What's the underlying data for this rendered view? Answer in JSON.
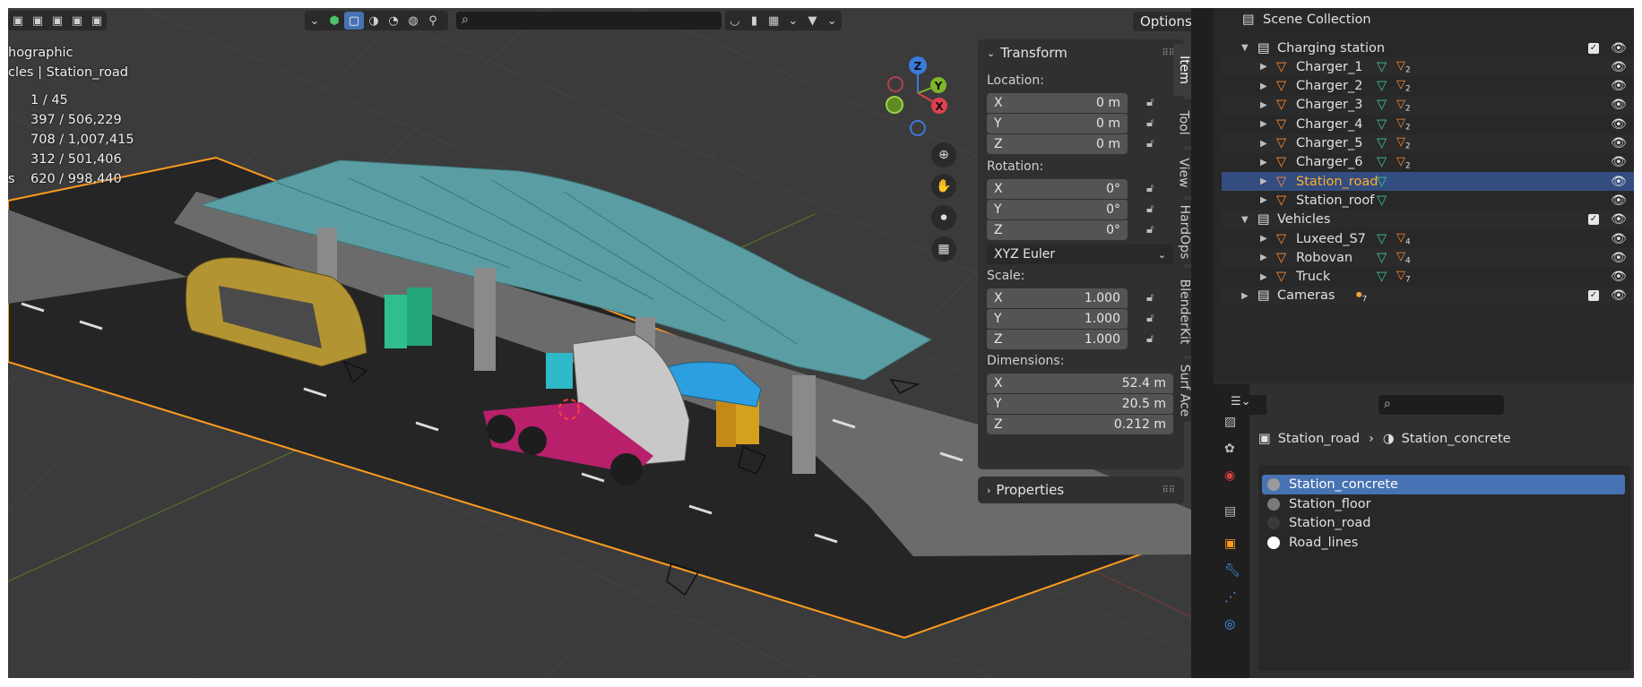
{
  "viewport": {
    "overlay": {
      "view_name": "hographic",
      "collection_path": "cles | Station_road",
      "stats": [
        {
          "label": "",
          "value": "1 / 45"
        },
        {
          "label": "",
          "value": "397 / 506,229"
        },
        {
          "label": "",
          "value": "708 / 1,007,415"
        },
        {
          "label": "",
          "value": "312 / 501,406"
        },
        {
          "label": "s",
          "value": "620 / 998,440"
        }
      ]
    },
    "options_label": "Options",
    "gizmo": {
      "x": "X",
      "y": "Y",
      "z": "Z"
    }
  },
  "npanel": {
    "transform": {
      "title": "Transform",
      "location_label": "Location:",
      "location": [
        {
          "axis": "X",
          "value": "0 m"
        },
        {
          "axis": "Y",
          "value": "0 m"
        },
        {
          "axis": "Z",
          "value": "0 m"
        }
      ],
      "rotation_label": "Rotation:",
      "rotation": [
        {
          "axis": "X",
          "value": "0°"
        },
        {
          "axis": "Y",
          "value": "0°"
        },
        {
          "axis": "Z",
          "value": "0°"
        }
      ],
      "rotation_mode": "XYZ Euler",
      "scale_label": "Scale:",
      "scale": [
        {
          "axis": "X",
          "value": "1.000"
        },
        {
          "axis": "Y",
          "value": "1.000"
        },
        {
          "axis": "Z",
          "value": "1.000"
        }
      ],
      "dimensions_label": "Dimensions:",
      "dimensions": [
        {
          "axis": "X",
          "value": "52.4 m"
        },
        {
          "axis": "Y",
          "value": "20.5 m"
        },
        {
          "axis": "Z",
          "value": "0.212 m"
        }
      ]
    },
    "properties_title": "Properties",
    "tabs": [
      "Item",
      "Tool",
      "View",
      "HardOps",
      "BlenderKit",
      "Surf Ace"
    ]
  },
  "outliner": {
    "root": "Scene Collection",
    "rows": [
      {
        "label": "Charging station",
        "kind": "collection",
        "badge": ""
      },
      {
        "label": "Charger_1",
        "kind": "object",
        "badge": "2"
      },
      {
        "label": "Charger_2",
        "kind": "object",
        "badge": "2"
      },
      {
        "label": "Charger_3",
        "kind": "object",
        "badge": "2"
      },
      {
        "label": "Charger_4",
        "kind": "object",
        "badge": "2"
      },
      {
        "label": "Charger_5",
        "kind": "object",
        "badge": "2"
      },
      {
        "label": "Charger_6",
        "kind": "object",
        "badge": "2"
      },
      {
        "label": "Station_road",
        "kind": "object",
        "badge": ""
      },
      {
        "label": "Station_roof",
        "kind": "object",
        "badge": ""
      },
      {
        "label": "Vehicles",
        "kind": "collection",
        "badge": ""
      },
      {
        "label": "Luxeed_S7",
        "kind": "object",
        "badge": "4"
      },
      {
        "label": "Robovan",
        "kind": "object",
        "badge": "4"
      },
      {
        "label": "Truck",
        "kind": "object",
        "badge": "7"
      },
      {
        "label": "Cameras",
        "kind": "collection",
        "badge": "7"
      }
    ],
    "selected": "Station_road"
  },
  "properties": {
    "breadcrumb_object": "Station_road",
    "breadcrumb_material": "Station_concrete",
    "materials": [
      {
        "name": "Station_concrete",
        "color": "#9a9a9a"
      },
      {
        "name": "Station_floor",
        "color": "#7a7a7a"
      },
      {
        "name": "Station_road",
        "color": "#3a3a3a"
      },
      {
        "name": "Road_lines",
        "color": "#ffffff"
      }
    ]
  },
  "colors": {
    "selection": "#4772b3",
    "outliner_selected_row": "#334d80",
    "selected_text": "#ffaf29",
    "active_outline": "#ff9b1d",
    "canopy": "#5a9ea3"
  }
}
